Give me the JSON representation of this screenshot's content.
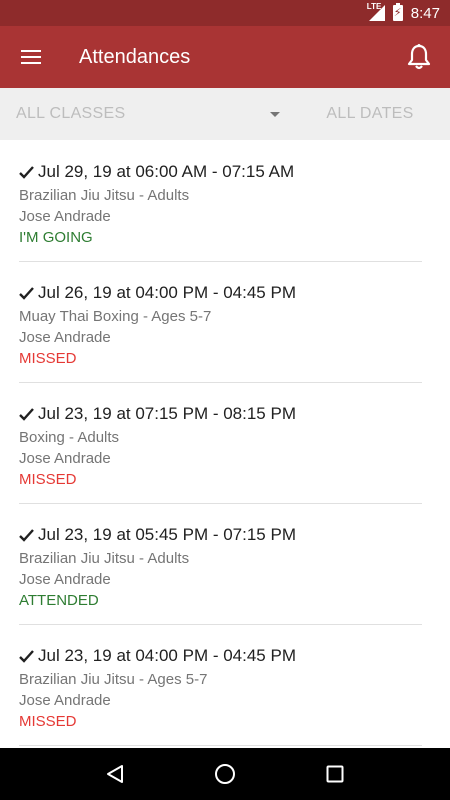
{
  "status_bar": {
    "network": "LTE",
    "time": "8:47"
  },
  "app_bar": {
    "title": "Attendances",
    "menu_icon": "menu-icon",
    "bell_icon": "bell-icon"
  },
  "filters": {
    "class_select": "ALL CLASSES",
    "dates_button": "ALL DATES"
  },
  "colors": {
    "status_bar": "#8e2b2b",
    "app_bar": "#a93434",
    "going": "#2e7d32",
    "attended": "#2e7d32",
    "missed": "#e53935"
  },
  "attendances": [
    {
      "datetime": "Jul 29, 19 at 06:00 AM - 07:15 AM",
      "class": "Brazilian Jiu Jitsu - Adults",
      "student": "Jose Andrade",
      "status": "I'M GOING",
      "status_color": "#2e7d32"
    },
    {
      "datetime": "Jul 26, 19 at 04:00 PM - 04:45 PM",
      "class": "Muay Thai Boxing - Ages 5-7",
      "student": "Jose Andrade",
      "status": "MISSED",
      "status_color": "#e53935"
    },
    {
      "datetime": "Jul 23, 19 at 07:15 PM - 08:15 PM",
      "class": "Boxing - Adults",
      "student": "Jose Andrade",
      "status": "MISSED",
      "status_color": "#e53935"
    },
    {
      "datetime": "Jul 23, 19 at 05:45 PM - 07:15 PM",
      "class": "Brazilian Jiu Jitsu - Adults",
      "student": "Jose Andrade",
      "status": "ATTENDED",
      "status_color": "#2e7d32"
    },
    {
      "datetime": "Jul 23, 19 at 04:00 PM - 04:45 PM",
      "class": "Brazilian Jiu Jitsu - Ages 5-7",
      "student": "Jose Andrade",
      "status": "MISSED",
      "status_color": "#e53935"
    }
  ]
}
